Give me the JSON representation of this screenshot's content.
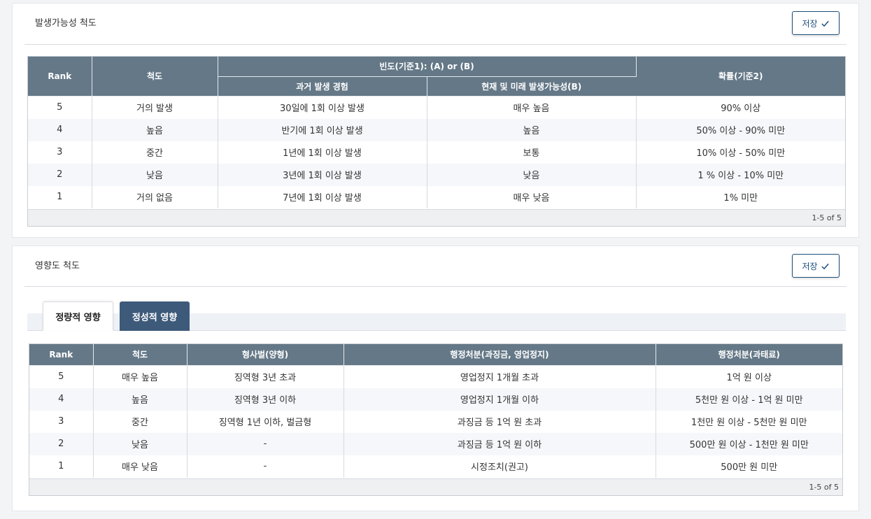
{
  "likelihood": {
    "title": "발생가능성 척도",
    "save_label": "저장",
    "header": {
      "rank": "Rank",
      "scale": "척도",
      "frequency_group": "빈도(기준1): (A) or (B)",
      "past": "과거 발생 경험",
      "future": "현재 및 미래 발생가능성(B)",
      "probability": "확률(기준2)"
    },
    "rows": [
      {
        "rank": "5",
        "scale": "거의 발생",
        "past": "30일에 1회 이상 발생",
        "future": "매우 높음",
        "probability": "90% 이상"
      },
      {
        "rank": "4",
        "scale": "높음",
        "past": "반기에 1회 이상 발생",
        "future": "높음",
        "probability": "50% 이상 - 90% 미만"
      },
      {
        "rank": "3",
        "scale": "중간",
        "past": "1년에 1회 이상 발생",
        "future": "보통",
        "probability": "10% 이상 - 50% 미만"
      },
      {
        "rank": "2",
        "scale": "낮음",
        "past": "3년에 1회 이상 발생",
        "future": "낮음",
        "probability": "1 % 이상 - 10% 미만"
      },
      {
        "rank": "1",
        "scale": "거의 없음",
        "past": "7년에 1회 이상 발생",
        "future": "매우 낮음",
        "probability": "1% 미만"
      }
    ],
    "pager": "1-5 of 5"
  },
  "impact": {
    "title": "영향도 척도",
    "save_label": "저장",
    "tabs": [
      "정량적 영향",
      "정성적 영향"
    ],
    "header": {
      "rank": "Rank",
      "scale": "척도",
      "criminal": "형사벌(양형)",
      "admin_fine": "행정처분(과징금, 영업정지)",
      "admin_penalty": "행정처분(과태료)"
    },
    "rows": [
      {
        "rank": "5",
        "scale": "매우 높음",
        "criminal": "징역형 3년 초과",
        "admin_fine": "영업정지 1개월 초과",
        "admin_penalty": "1억 원 이상"
      },
      {
        "rank": "4",
        "scale": "높음",
        "criminal": "징역형 3년 이하",
        "admin_fine": "영업정지 1개월 이하",
        "admin_penalty": "5천만 원 이상 - 1억 원 미만"
      },
      {
        "rank": "3",
        "scale": "중간",
        "criminal": "징역형 1년 이하, 벌금형",
        "admin_fine": "과징금 등 1억 원 초과",
        "admin_penalty": "1천만 원 이상 - 5천만 원 미만"
      },
      {
        "rank": "2",
        "scale": "낮음",
        "criminal": "-",
        "admin_fine": "과징금 등 1억 원 이하",
        "admin_penalty": "500만 원 이상 - 1천만 원 미만"
      },
      {
        "rank": "1",
        "scale": "매우 낮음",
        "criminal": "-",
        "admin_fine": "시정조치(권고)",
        "admin_penalty": "500만 원 미만"
      }
    ],
    "pager": "1-5 of 5"
  },
  "colors": {
    "header_bg": "#647887",
    "accent": "#1e4d7b",
    "tab_inactive": "#3d5a7a"
  }
}
